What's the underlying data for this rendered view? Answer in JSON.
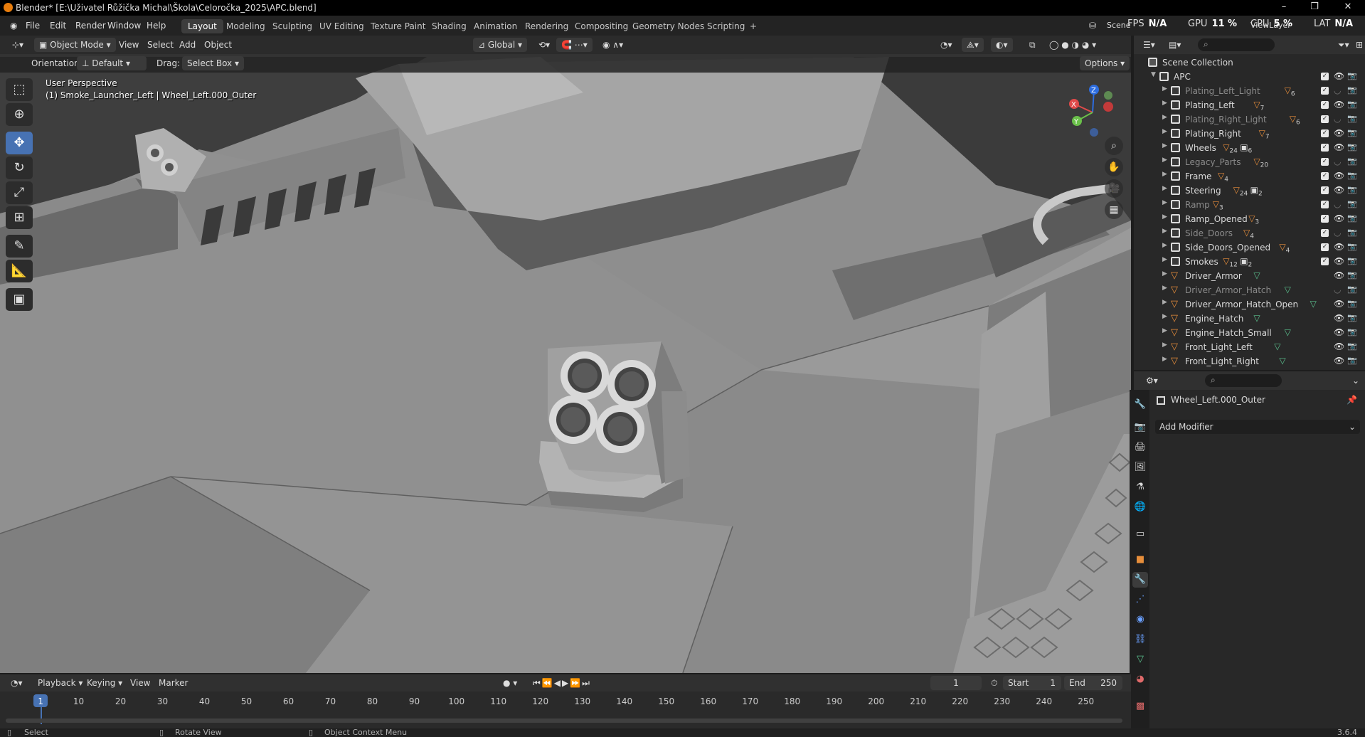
{
  "titlebar": {
    "title": "Blender* [E:\\Uživatel Růžička Michal\\Škola\\Celoročka_2025\\APC.blend]"
  },
  "menu": [
    "File",
    "Edit",
    "Render",
    "Window",
    "Help"
  ],
  "workspaces": [
    "Layout",
    "Modeling",
    "Sculpting",
    "UV Editing",
    "Texture Paint",
    "Shading",
    "Animation",
    "Rendering",
    "Compositing",
    "Geometry Nodes",
    "Scripting"
  ],
  "active_workspace": "Layout",
  "scene": {
    "label": "Scene",
    "viewlayer": "ViewLayer"
  },
  "perf": {
    "fps_label": "FPS",
    "fps": "N/A",
    "gpu_label": "GPU",
    "gpu": "11 %",
    "cpu_label": "CPU",
    "cpu": "5 %",
    "lat_label": "LAT",
    "lat": "N/A"
  },
  "viewport_header": {
    "mode": "Object Mode",
    "menus": [
      "View",
      "Select",
      "Add",
      "Object"
    ],
    "transform": "Global"
  },
  "viewport_header2": {
    "orientation_label": "Orientation:",
    "orientation": "Default",
    "drag_label": "Drag:",
    "drag": "Select Box",
    "options": "Options"
  },
  "viewport_overlay": {
    "perspective": "User Perspective",
    "object": "(1) Smoke_Launcher_Left | Wheel_Left.000_Outer"
  },
  "gizmo": {
    "x": "X",
    "y": "Y",
    "z": "Z"
  },
  "outliner": {
    "root": "Scene Collection",
    "collection": "APC",
    "items": [
      {
        "name": "Plating_Left_Light",
        "badge": "6",
        "dim": true,
        "kind": "coll"
      },
      {
        "name": "Plating_Left",
        "badge": "7",
        "dim": false,
        "kind": "coll"
      },
      {
        "name": "Plating_Right_Light",
        "badge": "6",
        "dim": true,
        "kind": "coll"
      },
      {
        "name": "Plating_Right",
        "badge": "7",
        "dim": false,
        "kind": "coll"
      },
      {
        "name": "Wheels",
        "badge": "24",
        "badge2": "6",
        "dim": false,
        "kind": "coll"
      },
      {
        "name": "Legacy_Parts",
        "badge": "20",
        "dim": true,
        "kind": "coll"
      },
      {
        "name": "Frame",
        "badge": "4",
        "dim": false,
        "kind": "coll"
      },
      {
        "name": "Steering",
        "badge": "24",
        "badge2": "2",
        "dim": false,
        "kind": "coll"
      },
      {
        "name": "Ramp",
        "badge": "3",
        "dim": true,
        "kind": "coll"
      },
      {
        "name": "Ramp_Opened",
        "badge": "3",
        "dim": false,
        "kind": "coll"
      },
      {
        "name": "Side_Doors",
        "badge": "4",
        "dim": true,
        "kind": "coll"
      },
      {
        "name": "Side_Doors_Opened",
        "badge": "4",
        "dim": false,
        "kind": "coll"
      },
      {
        "name": "Smokes",
        "badge": "12",
        "badge2": "2",
        "dim": false,
        "kind": "coll"
      },
      {
        "name": "Driver_Armor",
        "dim": false,
        "kind": "obj"
      },
      {
        "name": "Driver_Armor_Hatch",
        "dim": true,
        "kind": "obj"
      },
      {
        "name": "Driver_Armor_Hatch_Open",
        "dim": false,
        "kind": "obj"
      },
      {
        "name": "Engine_Hatch",
        "dim": false,
        "kind": "obj"
      },
      {
        "name": "Engine_Hatch_Small",
        "dim": false,
        "kind": "obj"
      },
      {
        "name": "Front_Light_Left",
        "dim": false,
        "kind": "obj"
      },
      {
        "name": "Front_Light_Right",
        "dim": false,
        "kind": "obj"
      }
    ]
  },
  "properties": {
    "object": "Wheel_Left.000_Outer",
    "add_modifier": "Add Modifier"
  },
  "timeline": {
    "menus": [
      "Playback",
      "Keying",
      "View",
      "Marker"
    ],
    "current_frame": "1",
    "start_label": "Start",
    "start": "1",
    "end_label": "End",
    "end": "250",
    "ticks": [
      "1",
      "10",
      "20",
      "30",
      "40",
      "50",
      "60",
      "70",
      "80",
      "90",
      "100",
      "110",
      "120",
      "130",
      "140",
      "150",
      "160",
      "170",
      "180",
      "190",
      "200",
      "210",
      "220",
      "230",
      "240",
      "250"
    ]
  },
  "status": {
    "select": "Select",
    "rotate": "Rotate View",
    "context": "Object Context Menu",
    "version": "3.6.4"
  }
}
